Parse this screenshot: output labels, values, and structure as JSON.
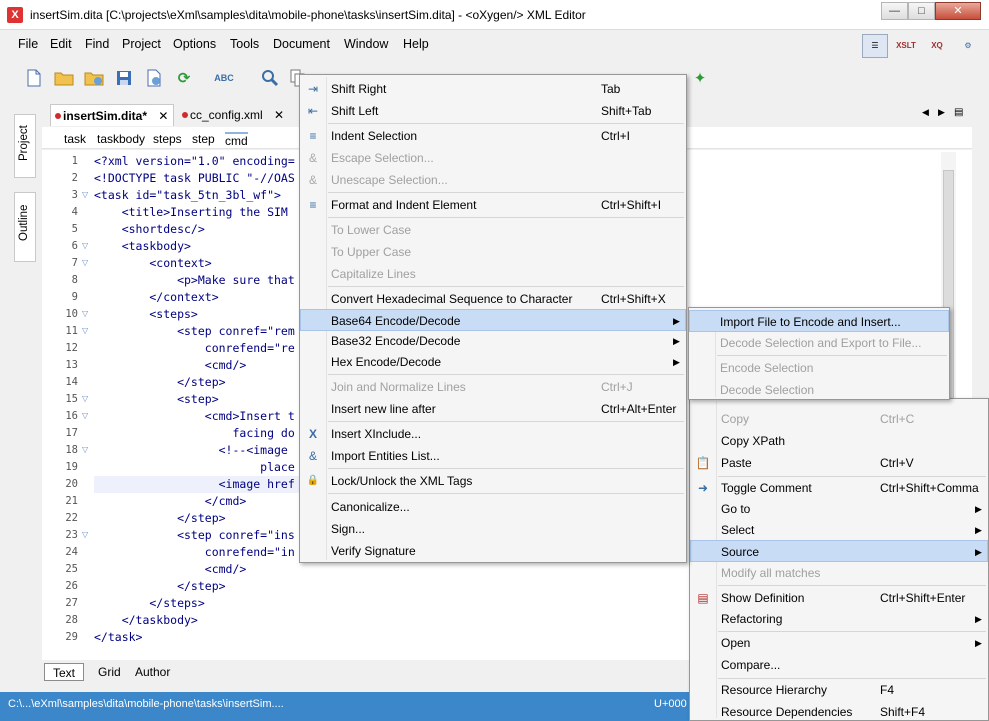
{
  "window": {
    "title": "insertSim.dita [C:\\projects\\eXml\\samples\\dita\\mobile-phone\\tasks\\insertSim.dita] - <oXygen/> XML Editor",
    "app_icon_label": "X",
    "min_label": "—",
    "max_label": "□",
    "close_label": "✕"
  },
  "menubar": [
    "File",
    "Edit",
    "Find",
    "Project",
    "Options",
    "Tools",
    "Document",
    "Window",
    "Help"
  ],
  "toolbar_right": [
    "☰",
    "XSLT",
    "XQ",
    "⚙"
  ],
  "side_tabs": {
    "project": "Project",
    "outline": "Outline"
  },
  "editor_tabs": [
    {
      "label": "insertSim.dita*",
      "close": "✕"
    },
    {
      "label": "cc_config.xml",
      "close": "✕"
    }
  ],
  "breadcrumb": [
    "task",
    "taskbody",
    "steps",
    "step",
    "cmd"
  ],
  "code_lines": [
    {
      "n": "1",
      "text": "<?xml version=\"1.0\" encoding=",
      "fold": ""
    },
    {
      "n": "2",
      "text": "<!DOCTYPE task PUBLIC \"-//OAS",
      "fold": ""
    },
    {
      "n": "3",
      "text": "<task id=\"task_5tn_3bl_wf\">",
      "fold": "▽"
    },
    {
      "n": "4",
      "text": "    <title>Inserting the SIM",
      "fold": ""
    },
    {
      "n": "5",
      "text": "    <shortdesc/>",
      "fold": ""
    },
    {
      "n": "6",
      "text": "    <taskbody>",
      "fold": "▽"
    },
    {
      "n": "7",
      "text": "        <context>",
      "fold": "▽"
    },
    {
      "n": "8",
      "text": "            <p>Make sure that",
      "fold": ""
    },
    {
      "n": "9",
      "text": "        </context>",
      "fold": ""
    },
    {
      "n": "10",
      "text": "        <steps>",
      "fold": "▽"
    },
    {
      "n": "11",
      "text": "            <step conref=\"rem",
      "fold": "▽"
    },
    {
      "n": "12",
      "text": "                conrefend=\"re",
      "fold": ""
    },
    {
      "n": "13",
      "text": "                <cmd/>",
      "fold": ""
    },
    {
      "n": "14",
      "text": "            </step>",
      "fold": ""
    },
    {
      "n": "15",
      "text": "            <step>",
      "fold": "▽"
    },
    {
      "n": "16",
      "text": "                <cmd>Insert t",
      "fold": "▽"
    },
    {
      "n": "17",
      "text": "                    facing do",
      "fold": ""
    },
    {
      "n": "18",
      "text": "                  <!--<image",
      "fold": "▽"
    },
    {
      "n": "19",
      "text": "                        place",
      "fold": ""
    },
    {
      "n": "20",
      "text": "                  <image href",
      "fold": ""
    },
    {
      "n": "21",
      "text": "                </cmd>",
      "fold": ""
    },
    {
      "n": "22",
      "text": "            </step>",
      "fold": ""
    },
    {
      "n": "23",
      "text": "            <step conref=\"ins",
      "fold": "▽"
    },
    {
      "n": "24",
      "text": "                conrefend=\"in",
      "fold": ""
    },
    {
      "n": "25",
      "text": "                <cmd/>",
      "fold": ""
    },
    {
      "n": "26",
      "text": "            </step>",
      "fold": ""
    },
    {
      "n": "27",
      "text": "        </steps>",
      "fold": ""
    },
    {
      "n": "28",
      "text": "    </taskbody>",
      "fold": ""
    },
    {
      "n": "29",
      "text": "</task>",
      "fold": ""
    }
  ],
  "bottom_tabs": [
    "Text",
    "Grid",
    "Author"
  ],
  "status": {
    "path": "C:\\...\\eXml\\samples\\dita\\mobile-phone\\tasks\\insertSim....",
    "encoding": "U+000"
  },
  "source_menu": [
    {
      "label": "Shift Right",
      "shortcut": "Tab",
      "icon": "⇥"
    },
    {
      "label": "Shift Left",
      "shortcut": "Shift+Tab",
      "icon": "⇤"
    },
    {
      "label": "Indent Selection",
      "shortcut": "Ctrl+I",
      "icon": "≡"
    },
    {
      "label": "Escape Selection...",
      "shortcut": "",
      "icon": "&"
    },
    {
      "label": "Unescape Selection...",
      "shortcut": "",
      "icon": "&"
    },
    {
      "label": "Format and Indent Element",
      "shortcut": "Ctrl+Shift+I",
      "icon": "≡"
    },
    {
      "label": "To Lower Case",
      "shortcut": "",
      "icon": ""
    },
    {
      "label": "To Upper Case",
      "shortcut": "",
      "icon": ""
    },
    {
      "label": "Capitalize Lines",
      "shortcut": "",
      "icon": ""
    },
    {
      "label": "Convert Hexadecimal Sequence to Character",
      "shortcut": "Ctrl+Shift+X",
      "icon": ""
    },
    {
      "label": "Base64 Encode/Decode",
      "shortcut": "",
      "icon": ""
    },
    {
      "label": "Base32 Encode/Decode",
      "shortcut": "",
      "icon": ""
    },
    {
      "label": "Hex Encode/Decode",
      "shortcut": "",
      "icon": ""
    },
    {
      "label": "Join and Normalize Lines",
      "shortcut": "Ctrl+J",
      "icon": ""
    },
    {
      "label": "Insert new line after",
      "shortcut": "Ctrl+Alt+Enter",
      "icon": ""
    },
    {
      "label": "Insert XInclude...",
      "shortcut": "",
      "icon": "X"
    },
    {
      "label": "Import Entities List...",
      "shortcut": "",
      "icon": "&"
    },
    {
      "label": "Lock/Unlock the XML Tags",
      "shortcut": "",
      "icon": "🔒"
    },
    {
      "label": "Canonicalize...",
      "shortcut": "",
      "icon": ""
    },
    {
      "label": "Sign...",
      "shortcut": "",
      "icon": ""
    },
    {
      "label": "Verify Signature",
      "shortcut": "",
      "icon": ""
    }
  ],
  "base64_menu": [
    {
      "label": "Import File to Encode and Insert..."
    },
    {
      "label": "Decode Selection and Export to File..."
    },
    {
      "label": "Encode Selection"
    },
    {
      "label": "Decode Selection"
    }
  ],
  "main_menu": [
    {
      "label": "Copy",
      "shortcut": "Ctrl+C",
      "icon": ""
    },
    {
      "label": "Copy XPath",
      "shortcut": "",
      "icon": ""
    },
    {
      "label": "Paste",
      "shortcut": "Ctrl+V",
      "icon": "📋"
    },
    {
      "label": "Toggle Comment",
      "shortcut": "Ctrl+Shift+Comma",
      "icon": "➜"
    },
    {
      "label": "Go to",
      "shortcut": "",
      "icon": ""
    },
    {
      "label": "Select",
      "shortcut": "",
      "icon": ""
    },
    {
      "label": "Source",
      "shortcut": "",
      "icon": ""
    },
    {
      "label": "Modify all matches",
      "shortcut": "",
      "icon": ""
    },
    {
      "label": "Show Definition",
      "shortcut": "Ctrl+Shift+Enter",
      "icon": "▤"
    },
    {
      "label": "Refactoring",
      "shortcut": "",
      "icon": ""
    },
    {
      "label": "Open",
      "shortcut": "",
      "icon": ""
    },
    {
      "label": "Compare...",
      "shortcut": "",
      "icon": ""
    },
    {
      "label": "Resource Hierarchy",
      "shortcut": "F4",
      "icon": ""
    },
    {
      "label": "Resource Dependencies",
      "shortcut": "Shift+F4",
      "icon": ""
    }
  ],
  "glyphs": {
    "submenu_arrow": "▶",
    "nav_left": "◀",
    "nav_right": "▶",
    "tab_list": "▤"
  },
  "colors": {
    "status_bar": "#3b87c9",
    "menu_highlight": "#c8dcf5",
    "modified_dot": "#d02b2b"
  }
}
